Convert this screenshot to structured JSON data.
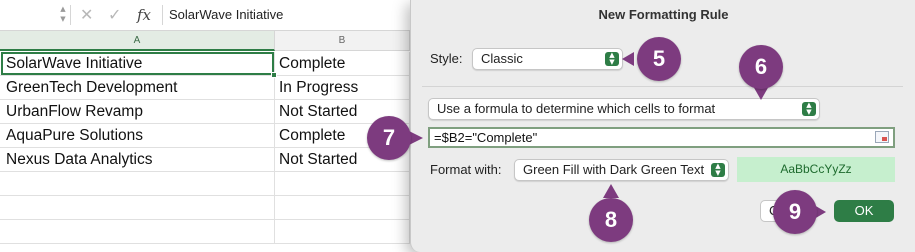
{
  "formula_bar": {
    "name_box": "",
    "content": "SolarWave Initiative",
    "fx_label": "fx"
  },
  "columns": [
    "A",
    "B"
  ],
  "rows": [
    {
      "a": "SolarWave Initiative",
      "b": "Complete"
    },
    {
      "a": "GreenTech Development",
      "b": "In Progress"
    },
    {
      "a": "UrbanFlow Revamp",
      "b": "Not Started"
    },
    {
      "a": "AquaPure Solutions",
      "b": "Complete"
    },
    {
      "a": "Nexus Data Analytics",
      "b": "Not Started"
    }
  ],
  "dialog": {
    "title": "New Formatting Rule",
    "style_label": "Style:",
    "style_value": "Classic",
    "rule_type": "Use a formula to determine which cells to format",
    "formula": "=$B2=\"Complete\"",
    "format_with_label": "Format with:",
    "format_with_value": "Green Fill with Dark Green Text",
    "preview_text": "AaBbCcYyZz",
    "cancel_label": "C",
    "ok_label": "OK"
  },
  "callouts": [
    "5",
    "6",
    "7",
    "8",
    "9"
  ],
  "colors": {
    "accent": "#2e7d46",
    "callout": "#7d3b7f",
    "preview_fill": "#c6efce",
    "preview_text": "#1e6b2e"
  }
}
